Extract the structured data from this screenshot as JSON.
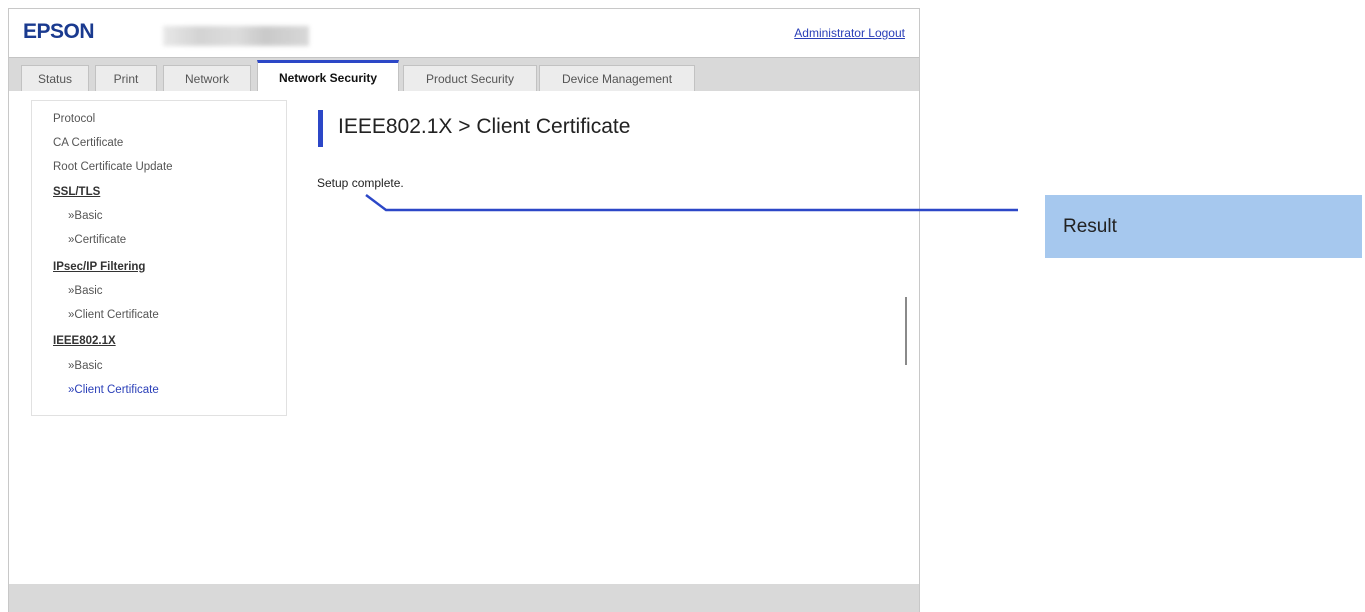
{
  "header": {
    "logo": "EPSON",
    "logout_link": "Administrator Logout"
  },
  "tabs": [
    {
      "label": "Status",
      "active": false
    },
    {
      "label": "Print",
      "active": false
    },
    {
      "label": "Network",
      "active": false
    },
    {
      "label": "Network Security",
      "active": true
    },
    {
      "label": "Product Security",
      "active": false
    },
    {
      "label": "Device Management",
      "active": false
    }
  ],
  "sidebar": {
    "items": [
      {
        "label": "Protocol",
        "kind": "link"
      },
      {
        "label": "CA Certificate",
        "kind": "link"
      },
      {
        "label": "Root Certificate Update",
        "kind": "link"
      },
      {
        "label": "SSL/TLS",
        "kind": "section"
      },
      {
        "label": "»Basic",
        "kind": "sub"
      },
      {
        "label": "»Certificate",
        "kind": "sub"
      },
      {
        "label": "IPsec/IP Filtering",
        "kind": "section"
      },
      {
        "label": "»Basic",
        "kind": "sub"
      },
      {
        "label": "»Client Certificate",
        "kind": "sub"
      },
      {
        "label": "IEEE802.1X",
        "kind": "section"
      },
      {
        "label": "»Basic",
        "kind": "sub"
      },
      {
        "label": "»Client Certificate",
        "kind": "sub",
        "active": true
      }
    ]
  },
  "main": {
    "title": "IEEE802.1X > Client Certificate",
    "status_message": "Setup complete."
  },
  "callout": {
    "label": "Result"
  },
  "colors": {
    "accent": "#2c47c7",
    "link": "#2a3fb8",
    "callout_fill": "#a6c8ee",
    "tabbar": "#d9d9d9"
  }
}
